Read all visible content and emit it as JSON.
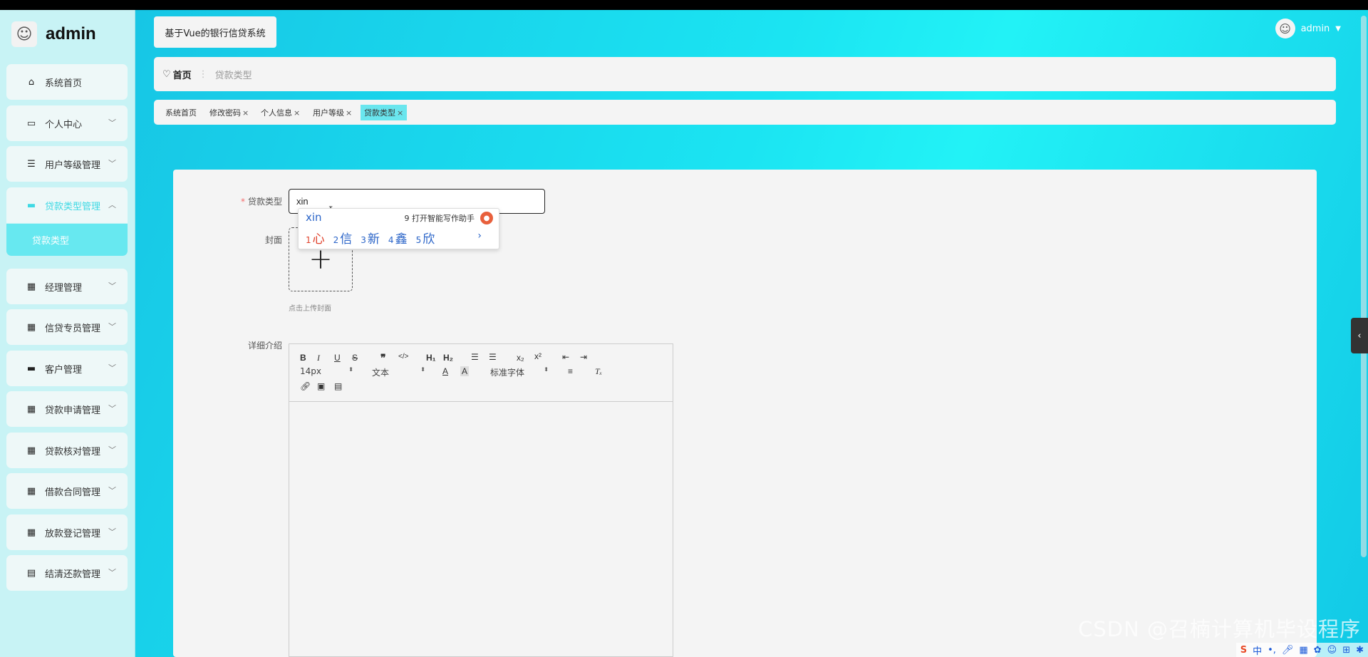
{
  "brand": {
    "name": "admin",
    "logo_icon": "avatar-icon"
  },
  "sidebar": {
    "items": [
      {
        "label": "系统首页",
        "icon": "⌂",
        "chevron": false
      },
      {
        "label": "个人中心",
        "icon": "▭",
        "chevron": true
      },
      {
        "label": "用户等级管理",
        "icon": "☰",
        "chevron": true
      },
      {
        "label": "贷款类型管理",
        "icon": "▬",
        "chevron": true,
        "expanded": true
      },
      {
        "label": "经理管理",
        "icon": "▦",
        "chevron": true
      },
      {
        "label": "信贷专员管理",
        "icon": "▦",
        "chevron": true
      },
      {
        "label": "客户管理",
        "icon": "▬",
        "chevron": true
      },
      {
        "label": "贷款申请管理",
        "icon": "▦",
        "chevron": true
      },
      {
        "label": "贷款核对管理",
        "icon": "▦",
        "chevron": true
      },
      {
        "label": "借款合同管理",
        "icon": "▦",
        "chevron": true
      },
      {
        "label": "放款登记管理",
        "icon": "▦",
        "chevron": true
      },
      {
        "label": "结清还款管理",
        "icon": "▤",
        "chevron": true
      }
    ],
    "submenu_active": "贷款类型",
    "active_color": "#3fd9e4"
  },
  "header": {
    "system_title": "基于Vue的银行信贷系统",
    "user_name": "admin",
    "user_menu_arrow": "▼"
  },
  "breadcrumb": {
    "home": "首页",
    "separator": "⋮",
    "current": "贷款类型"
  },
  "tabs": [
    {
      "label": "系统首页",
      "closable": false
    },
    {
      "label": "修改密码",
      "closable": true
    },
    {
      "label": "个人信息",
      "closable": true
    },
    {
      "label": "用户等级",
      "closable": true
    },
    {
      "label": "贷款类型",
      "closable": true,
      "active": true
    }
  ],
  "form": {
    "loan_type_label": "贷款类型",
    "loan_type_value": "xin",
    "cover_label": "封面",
    "upload_tip": "点击上传封面",
    "detail_label": "详细介绍"
  },
  "ime": {
    "pinyin": "xin",
    "assist_text": "9 打开智能写作助手",
    "candidates": [
      {
        "num": "1",
        "char": "心"
      },
      {
        "num": "2",
        "char": "信"
      },
      {
        "num": "3",
        "char": "新"
      },
      {
        "num": "4",
        "char": "鑫"
      },
      {
        "num": "5",
        "char": "欣"
      }
    ],
    "next": "›"
  },
  "editor": {
    "font_size": "14px",
    "block_type": "文本",
    "font_family": "标准字体"
  },
  "watermark": "CSDN @召楠计算机毕设程序",
  "tray": {
    "ime_lang": "中"
  }
}
